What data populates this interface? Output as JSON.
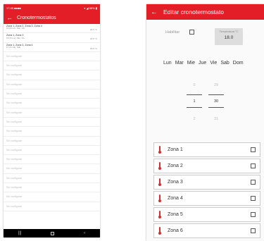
{
  "left": {
    "status": {
      "left": "17:35 ■■■■",
      "right": "▾ ◢ 86% ▮"
    },
    "app_bar": {
      "back": "←",
      "title": "Cronotermostatos"
    },
    "configured": [
      {
        "zones": "Zona 1, Zona 2, Zona 3, Zona 4",
        "schedule": "16:00  Lun, Mar, Vie",
        "temp": "20.0 °C"
      },
      {
        "zones": "Zona 1, Zona 3",
        "schedule": "19:15  Lun, Mie, Vie",
        "temp": "22.0 °C"
      },
      {
        "zones": "Zona 1, Zona 3, Zona 4",
        "schedule": "17:24  Jue, Sab",
        "temp": "18.5 °C"
      }
    ],
    "unconfigured_label": "Sin configurar",
    "unconfigured_count": 17
  },
  "right": {
    "app_bar": {
      "back": "←",
      "title": "Editar cronotermostato"
    },
    "enable_label": "Habilitar",
    "temp_label": "Temperatura °C",
    "temp_value": "18.0",
    "days": [
      "Lun",
      "Mar",
      "Mie",
      "Jue",
      "Vie",
      "Sab",
      "Dom"
    ],
    "time": {
      "hour_prev": "0",
      "hour": "1",
      "hour_next": "2",
      "min_prev": "29",
      "min": "30",
      "min_next": "31"
    },
    "zones": [
      "Zona 1",
      "Zona 2",
      "Zona 3",
      "Zona 4",
      "Zona 5",
      "Zona 6"
    ]
  },
  "colors": {
    "accent": "#e41e26",
    "thermo": "#d32f2f"
  }
}
